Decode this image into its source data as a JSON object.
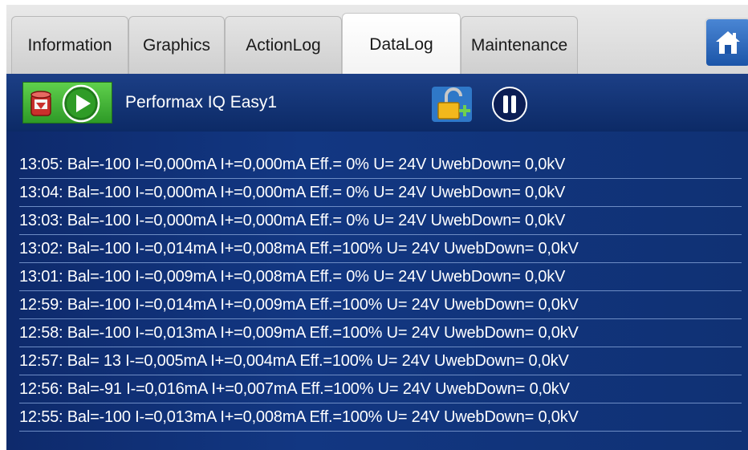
{
  "tabs": [
    {
      "label": "Information",
      "active": false
    },
    {
      "label": "Graphics",
      "active": false
    },
    {
      "label": "ActionLog",
      "active": false
    },
    {
      "label": "DataLog",
      "active": true
    },
    {
      "label": "Maintenance",
      "active": false
    }
  ],
  "icons": {
    "home": "home-icon",
    "stop": "stop-icon",
    "play": "play-icon",
    "lock": "unlock-icon",
    "pause": "pause-icon"
  },
  "colors": {
    "panel_bg": "#123782",
    "play_green": "#2e9a27",
    "accent_blue": "#1b55a8"
  },
  "device": {
    "name": "Performax IQ Easy1"
  },
  "log": {
    "rows": [
      "13:05: Bal=-100 I-=0,000mA I+=0,000mA Eff.=  0% U= 24V UwebDown=   0,0kV",
      "13:04: Bal=-100 I-=0,000mA I+=0,000mA Eff.=  0% U= 24V UwebDown=   0,0kV",
      "13:03: Bal=-100 I-=0,000mA I+=0,000mA Eff.=  0% U= 24V UwebDown=   0,0kV",
      "13:02: Bal=-100 I-=0,014mA I+=0,008mA Eff.=100% U= 24V UwebDown=   0,0kV",
      "13:01: Bal=-100 I-=0,009mA I+=0,008mA Eff.=  0% U= 24V UwebDown=   0,0kV",
      "12:59: Bal=-100 I-=0,014mA I+=0,009mA Eff.=100% U= 24V UwebDown=   0,0kV",
      "12:58: Bal=-100 I-=0,013mA I+=0,009mA Eff.=100% U= 24V UwebDown=   0,0kV",
      "12:57: Bal= 13 I-=0,005mA I+=0,004mA Eff.=100% U= 24V UwebDown=   0,0kV",
      "12:56: Bal=-91 I-=0,016mA I+=0,007mA Eff.=100% U= 24V UwebDown=   0,0kV",
      "12:55: Bal=-100 I-=0,013mA I+=0,008mA Eff.=100% U= 24V UwebDown=   0,0kV"
    ]
  }
}
